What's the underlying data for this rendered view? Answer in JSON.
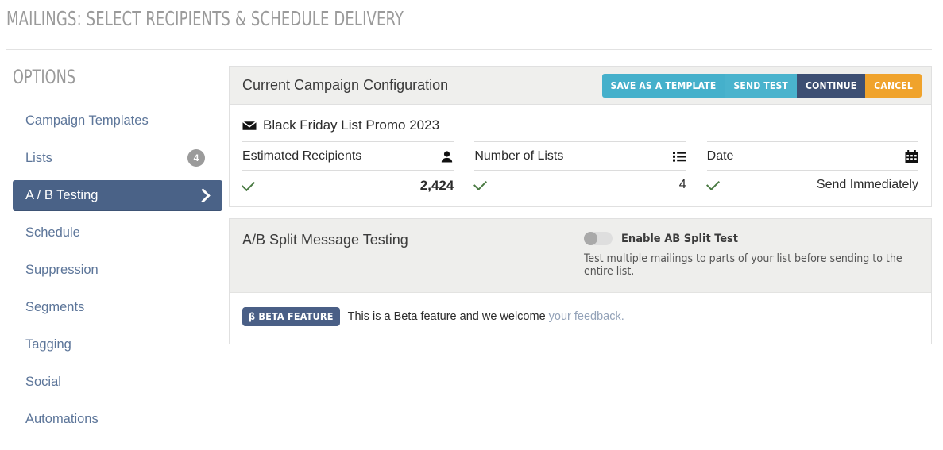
{
  "page": {
    "title": "MAILINGS: SELECT RECIPIENTS & SCHEDULE DELIVERY"
  },
  "sidebar": {
    "title": "OPTIONS",
    "items": [
      {
        "label": "Campaign Templates",
        "badge": null,
        "active": false
      },
      {
        "label": "Lists",
        "badge": "4",
        "active": false
      },
      {
        "label": "A / B Testing",
        "badge": null,
        "active": true
      },
      {
        "label": "Schedule",
        "badge": null,
        "active": false
      },
      {
        "label": "Suppression",
        "badge": null,
        "active": false
      },
      {
        "label": "Segments",
        "badge": null,
        "active": false
      },
      {
        "label": "Tagging",
        "badge": null,
        "active": false
      },
      {
        "label": "Social",
        "badge": null,
        "active": false
      },
      {
        "label": "Automations",
        "badge": null,
        "active": false
      }
    ]
  },
  "config_card": {
    "title": "Current Campaign Configuration",
    "buttons": [
      {
        "label": "SAVE AS A TEMPLATE",
        "color": "#45b0cb"
      },
      {
        "label": "SEND TEST",
        "color": "#4ab3cd"
      },
      {
        "label": "CONTINUE",
        "color": "#3d4f73"
      },
      {
        "label": "CANCEL",
        "color": "#f0a32c"
      }
    ],
    "campaign_name": "Black Friday List Promo 2023",
    "campaign_icon": "envelope-icon",
    "stats": [
      {
        "label": "Estimated Recipients",
        "icon": "person-icon",
        "value": "2,424",
        "bold": true,
        "checked": true
      },
      {
        "label": "Number of Lists",
        "icon": "list-icon",
        "value": "4",
        "bold": false,
        "checked": true
      },
      {
        "label": "Date",
        "icon": "calendar-icon",
        "value": "Send Immediately",
        "bold": false,
        "checked": true
      }
    ]
  },
  "ab_card": {
    "title": "A/B Split Message Testing",
    "toggle_label": "Enable AB Split Test",
    "toggle_on": false,
    "description": "Test multiple mailings to parts of your list before sending to the entire list.",
    "beta_badge": "β BETA FEATURE",
    "beta_text": "This is a Beta feature and we welcome ",
    "beta_link": "your feedback."
  },
  "colors": {
    "accent_active": "#4a6287",
    "link": "#5c7599",
    "teal": "#45b0cb",
    "navy": "#3d4f73",
    "orange": "#f0a32c",
    "check_green": "#4a7a43",
    "badge_gray": "#9b9b9b",
    "beta_navy": "#4a5f86"
  }
}
